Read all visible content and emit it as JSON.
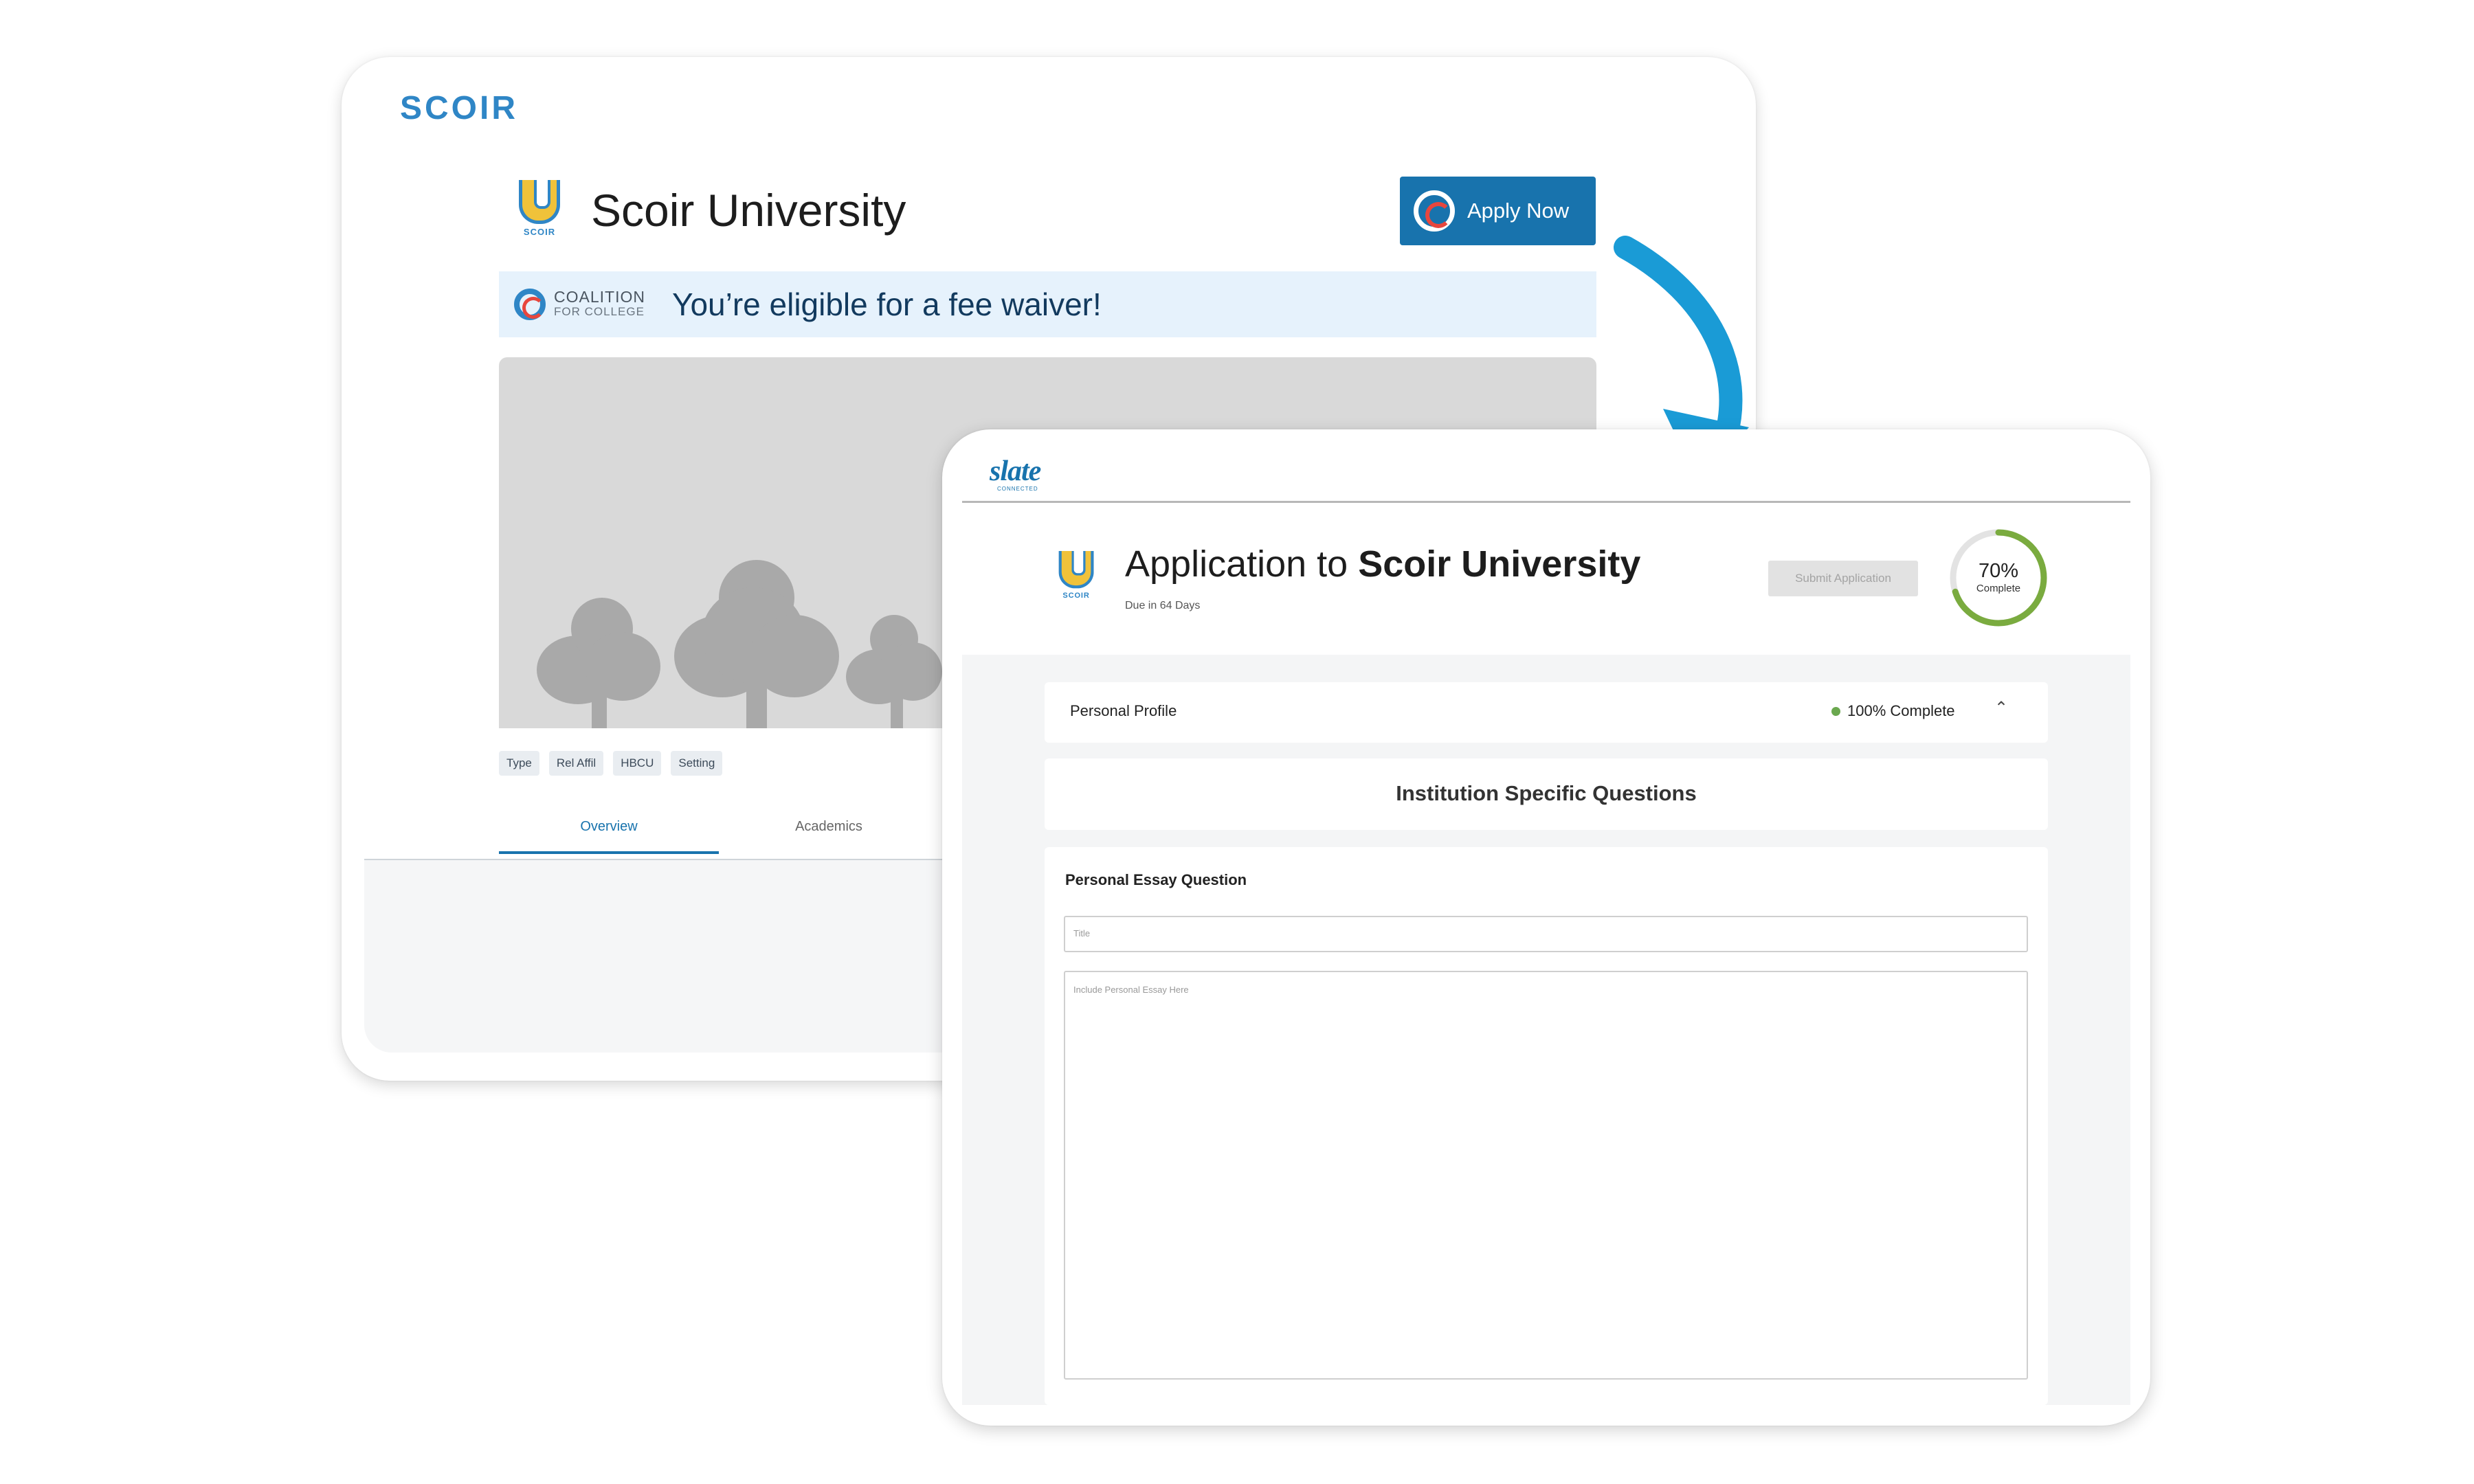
{
  "scoir_page": {
    "brand": "SCOIR",
    "university_name": "Scoir University",
    "logo_caption": "SCOIR",
    "apply_button": "Apply Now",
    "coalition": {
      "line1": "COALITION",
      "line2": "FOR COLLEGE"
    },
    "fee_waiver_text": "You’re eligible for a fee waiver!",
    "tags": [
      "Type",
      "Rel Affil",
      "HBCU",
      "Setting"
    ],
    "tabs": [
      "Overview",
      "Academics"
    ],
    "active_tab": "Overview"
  },
  "slate_page": {
    "brand": "slate",
    "brand_sub": "CONNECTED",
    "logo_caption": "SCOIR",
    "title_prefix": "Application to",
    "title_bold": "Scoir University",
    "due": "Due in 64 Days",
    "submit_button": "Submit Application",
    "progress": {
      "value": 70,
      "label": "70%",
      "caption": "Complete"
    },
    "personal_profile": {
      "title": "Personal Profile",
      "status": "100% Complete"
    },
    "section_heading": "Institution Specific Questions",
    "essay_question": "Personal Essay Question",
    "title_placeholder": "Title",
    "essay_placeholder": "Include Personal Essay Here"
  },
  "colors": {
    "accent_blue": "#1873ad",
    "brand_blue": "#2f86c6",
    "coalition_red": "#e8463d",
    "progress_green": "#7aab3f",
    "arrow_blue": "#1a9bd6"
  }
}
